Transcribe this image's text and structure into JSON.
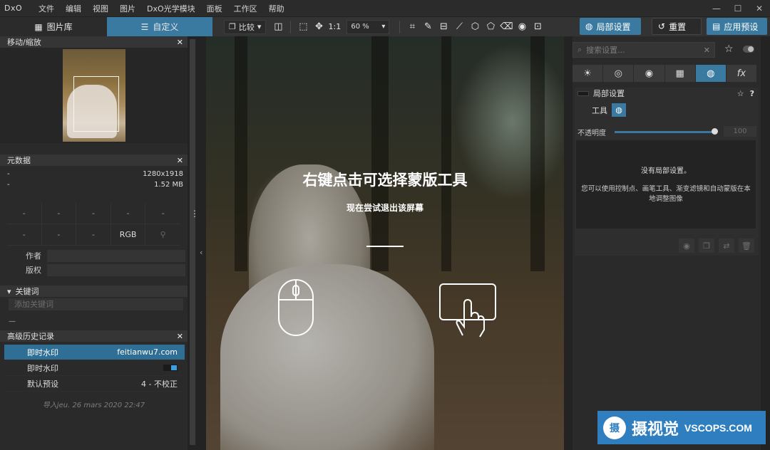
{
  "menubar": {
    "logo": "DxO",
    "items": [
      "文件",
      "编辑",
      "视图",
      "图片",
      "DxO光学模块",
      "面板",
      "工作区",
      "帮助"
    ]
  },
  "toolbar": {
    "tab_library": "图片库",
    "tab_custom": "自定义",
    "compare": "比较",
    "ratio": "1:1",
    "zoom": "60 %",
    "local_adjust": "局部设置",
    "reset": "重置",
    "apply_preset": "应用预设"
  },
  "left": {
    "navigator_title": "移动/缩放",
    "metadata_title": "元数据",
    "meta_rows": [
      {
        "label": "-",
        "value": "1280x1918"
      },
      {
        "label": "-",
        "value": "1.52 MB"
      }
    ],
    "meta_grid": [
      "-",
      "-",
      "-",
      "-",
      "-",
      "-",
      "-",
      "-",
      "RGB",
      ""
    ],
    "author_label": "作者",
    "copyright_label": "版权",
    "keywords_title": "关键词",
    "keywords_placeholder": "添加关键词",
    "keywords_dash": "—",
    "history_title": "高级历史记录",
    "history": [
      {
        "name": "即时水印",
        "value": "feitianwu7.com"
      },
      {
        "name": "即时水印",
        "value": ""
      },
      {
        "name": "默认预设",
        "value": "4 - 不校正"
      }
    ],
    "import_line": "导入jeu. 26 mars 2020 22:47"
  },
  "center": {
    "title": "右键点击可选择蒙版工具",
    "subtitle": "现在尝试退出该屏幕"
  },
  "right": {
    "search_placeholder": "搜索设置...",
    "palette_tabs": [
      "☀",
      "◎",
      "◉",
      "▦",
      "◍",
      "fx"
    ],
    "panel_title": "局部设置",
    "tools_label": "工具",
    "opacity_label": "不透明度",
    "opacity_value": "100",
    "empty_title": "没有局部设置。",
    "empty_desc": "您可以使用控制点、画笔工具、渐变滤镜和自动蒙版在本地调整图像"
  },
  "watermark": {
    "cn": "摄视觉",
    "en": "VSCOPS.COM"
  },
  "colors": {
    "accent": "#3a7aa0",
    "watermark_bg": "#2f7ec0"
  }
}
